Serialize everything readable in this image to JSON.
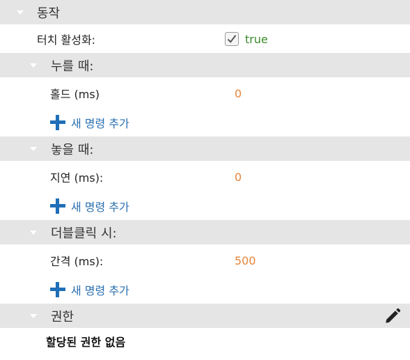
{
  "sections": {
    "action": {
      "title": "동작"
    },
    "touch": {
      "label": "터치 활성화:",
      "checked_text": "true"
    },
    "on_press": {
      "title": "누를 때:",
      "field_label": "홀드 (ms)",
      "field_value": "0",
      "add_label": "새 명령 추가"
    },
    "on_release": {
      "title": "놓을 때:",
      "field_label": "지연 (ms):",
      "field_value": "0",
      "add_label": "새 명령 추가"
    },
    "on_double": {
      "title": "더블클릭 시:",
      "field_label": "간격 (ms):",
      "field_value": "500",
      "add_label": "새 명령 추가"
    },
    "permissions": {
      "title": "권한",
      "empty_text": "할당된 권한 없음"
    }
  },
  "colors": {
    "header_bg": "#e5e5e5",
    "value": "#e6843a",
    "true_text": "#3a8a2a",
    "link": "#2a6fb0"
  }
}
